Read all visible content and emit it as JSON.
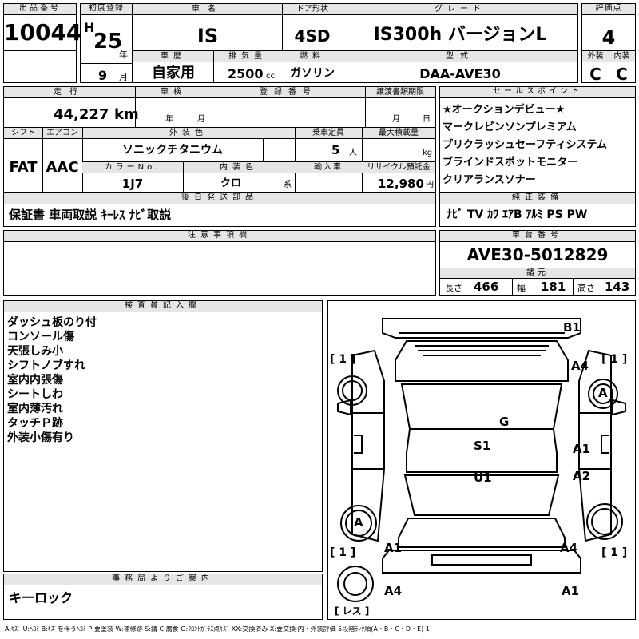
{
  "header": {
    "lot_no_label": "出品番号",
    "lot_no": "10044",
    "first_reg_label": "初度登録",
    "era": "H",
    "year": "25",
    "year_unit": "年",
    "month": "9",
    "month_unit": "月",
    "car_name_label": "車名",
    "car_name": "IS",
    "door_label": "ドア形状",
    "door": "4SD",
    "grade_label": "グレード",
    "grade": "IS300h バージョンL",
    "score_label": "評価点",
    "score": "4",
    "history_label": "車歴",
    "history": "自家用",
    "displacement_label": "排気量",
    "displacement": "2500",
    "displacement_unit": "cc",
    "fuel_label": "燃料",
    "fuel": "ガソリン",
    "model_label": "型式",
    "model": "DAA-AVE30",
    "exterior_label": "外装",
    "exterior": "C",
    "interior_label": "内装",
    "interior": "C"
  },
  "details": {
    "mileage_label": "走行",
    "mileage": "44,227",
    "mileage_unit": "km",
    "inspection_label": "車検",
    "inspection_year_unit": "年",
    "inspection_month_unit": "月",
    "reg_no_label": "登録番号",
    "transfer_label": "譲渡書類期限",
    "transfer_month_unit": "月",
    "transfer_day_unit": "日",
    "shift_label": "シフト",
    "shift": "FAT",
    "ac_label": "エアコン",
    "ac": "AAC",
    "color_label": "外装色",
    "color": "ソニックチタニウム",
    "capacity_label": "乗車定員",
    "capacity": "5",
    "capacity_unit": "人",
    "load_label": "最大積載量",
    "load_unit": "kg",
    "color_no_label": "カラーNo.",
    "color_no": "1J7",
    "int_color_label": "内装色",
    "int_color": "クロ",
    "int_color_unit": "系",
    "import_label": "輸入車",
    "recycle_label": "リサイクル預託金",
    "recycle": "12,980",
    "recycle_unit": "円",
    "later_label": "後日発送部品",
    "later_items": "保証書 車両取説 ｷｰﾚｽ ﾅﾋﾞ取説"
  },
  "sales_points": {
    "label": "セールスポイント",
    "items": [
      "★オークションデビュー★",
      "マークレビンソンプレミアム",
      "プリクラッシュセーフティシステム",
      "ブラインドスポットモニター",
      "クリアランスソナー"
    ]
  },
  "equipment": {
    "label": "純正装備",
    "items": "ﾅﾋﾞ TV ｶﾜ ｴｱB ｱﾙﾐ PS PW"
  },
  "notes": {
    "label": "注意事項欄"
  },
  "chassis": {
    "label": "車台番号",
    "number": "AVE30-5012829",
    "dim_label": "諸元",
    "length_label": "長さ",
    "length": "466",
    "width_label": "幅",
    "width": "181",
    "height_label": "高さ",
    "height": "143"
  },
  "inspector": {
    "label": "検査員記入欄",
    "items": [
      "ダッシュ板のり付",
      "コンソール傷",
      "天張しみ小",
      "シフトノブすれ",
      "室内内張傷",
      "シートしわ",
      "室内薄汚れ",
      "タッチＰ跡",
      "外装小傷有り"
    ]
  },
  "office": {
    "label": "事務局よりご案内",
    "text": "キーロック"
  },
  "diagram": {
    "marks": {
      "b1": "B1",
      "a4_tr": "A4",
      "a_rf": "A",
      "g": "G",
      "s1": "S1",
      "a1_r": "A1",
      "u1": "U1",
      "a2_r": "A2",
      "a_lr": "A",
      "a1_lr": "A1",
      "a4_rr": "A4",
      "a4_rb": "A4",
      "a1_rb": "A1"
    },
    "brackets": {
      "tl": "[ 1 ]",
      "tr": "[ 1 ]",
      "bl": "[ 1 ]",
      "br": "[ 1 ]",
      "spare": "[ レス ]"
    }
  },
  "legend": "A:ｷｽﾞ U:ﾍｺﾐ B:ｷｽﾞを伴うﾍｺﾐ P:要塗装 W:補修跡 S:錆 C:腐食 G:ﾌﾛﾝﾄｶﾞﾗｽ点ｷｽﾞ XX:交換済み X:要交換 内・外装評価 5段階ﾗﾝｸ順(A・B・C・D・E) 1"
}
